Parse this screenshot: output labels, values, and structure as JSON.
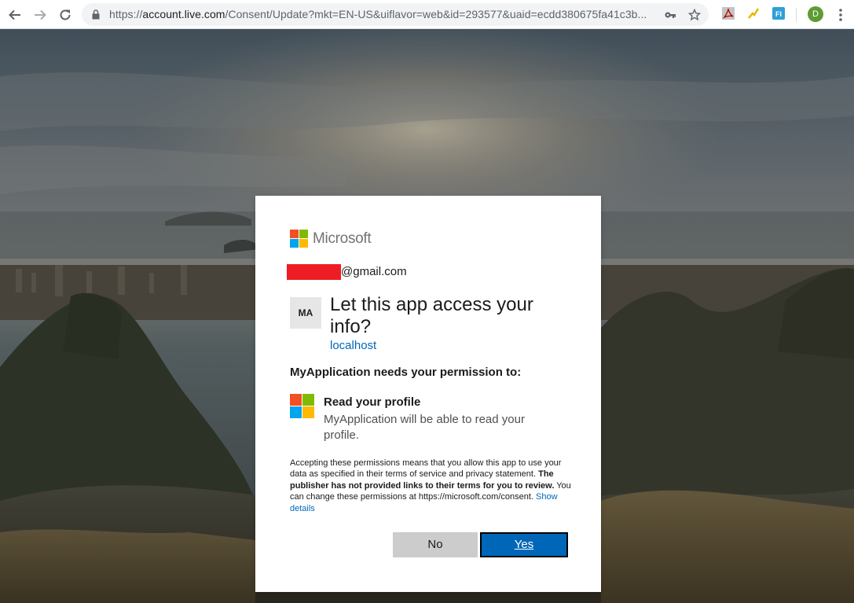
{
  "browser": {
    "url_prefix": "https://",
    "url_host": "account.live.com",
    "url_rest": "/Consent/Update?mkt=EN-US&uiflavor=web&id=293577&uaid=ecdd380675fa41c3b...",
    "profile_initial": "D",
    "extensions": [
      "pdf-extension-icon",
      "bolt-extension-icon",
      "fi-extension-icon"
    ],
    "extension_fi_label": "FI"
  },
  "dialog": {
    "brand": "Microsoft",
    "email_suffix": "@gmail.com",
    "app_tile": "MA",
    "title": "Let this app access your info?",
    "host": "localhost",
    "needs_text": "MyApplication needs your permission to:",
    "permission": {
      "title": "Read your profile",
      "description": "MyApplication will be able to read your profile."
    },
    "fine_print": {
      "part1": "Accepting these permissions means that you allow this app to use your data as specified in their terms of service and privacy statement. ",
      "bold": "The publisher has not provided links to their terms for you to review.",
      "part2": " You can change these permissions at https://microsoft.com/consent. ",
      "link": "Show details"
    },
    "buttons": {
      "no": "No",
      "yes": "Yes"
    }
  },
  "colors": {
    "accent": "#0067b8",
    "redaction": "#ee1d23",
    "logo": [
      "#f25022",
      "#7fba00",
      "#00a4ef",
      "#ffb900"
    ]
  }
}
